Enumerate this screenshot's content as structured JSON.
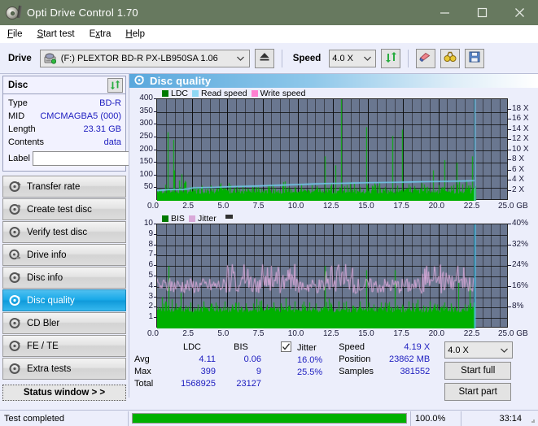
{
  "window": {
    "title": "Opti Drive Control 1.70",
    "icon": "disc-pen-icon",
    "minimize_label": "–",
    "maximize_label": "□",
    "close_label": "✕",
    "titlebar_color": "#67795f"
  },
  "menubar": {
    "items": [
      {
        "label": "File",
        "accel": "F"
      },
      {
        "label": "Start test",
        "accel": "S"
      },
      {
        "label": "Extra",
        "accel": "x"
      },
      {
        "label": "Help",
        "accel": "H"
      }
    ]
  },
  "toolbar": {
    "drive_label": "Drive",
    "drive_value": "(F:)  PLEXTOR BD-R  PX-LB950SA 1.06",
    "drive_icon": "drive-icon",
    "eject_icon": "eject-icon",
    "speed_label": "Speed",
    "speed_value": "4.0 X",
    "refresh_icon": "refresh-icon",
    "eraser_icon": "eraser-icon",
    "binoculars_icon": "binoculars-icon",
    "save_icon": "save-icon",
    "dropdown_icon": "chevron-down-icon"
  },
  "disc_panel": {
    "title": "Disc",
    "refresh_icon": "refresh-icon",
    "disc_icon": "disc-icon",
    "rows": [
      {
        "key": "Type",
        "value": "BD-R"
      },
      {
        "key": "MID",
        "value": "CMCMAGBA5 (000)"
      },
      {
        "key": "Length",
        "value": "23.31 GB"
      },
      {
        "key": "Contents",
        "value": "data"
      }
    ],
    "label_key": "Label",
    "label_value": ""
  },
  "sidebar": {
    "items": [
      {
        "label": "Transfer rate",
        "icon": "disc-test-icon",
        "active": false
      },
      {
        "label": "Create test disc",
        "icon": "disc-burn-icon",
        "active": false
      },
      {
        "label": "Verify test disc",
        "icon": "disc-verify-icon",
        "active": false
      },
      {
        "label": "Drive info",
        "icon": "disc-drive-icon",
        "active": false
      },
      {
        "label": "Disc info",
        "icon": "disc-info-icon",
        "active": false
      },
      {
        "label": "Disc quality",
        "icon": "disc-quality-icon",
        "active": true
      },
      {
        "label": "CD Bler",
        "icon": "disc-bler-icon",
        "active": false
      },
      {
        "label": "FE / TE",
        "icon": "disc-fete-icon",
        "active": false
      },
      {
        "label": "Extra tests",
        "icon": "disc-extra-icon",
        "active": false
      }
    ],
    "status_window_label": "Status window > >"
  },
  "panel": {
    "header_title": "Disc quality",
    "header_icon": "disc-quality-icon"
  },
  "stats": {
    "col_ldc": "LDC",
    "col_bis": "BIS",
    "rows": [
      {
        "key": "Avg",
        "ldc": "4.11",
        "bis": "0.06"
      },
      {
        "key": "Max",
        "ldc": "399",
        "bis": "9"
      },
      {
        "key": "Total",
        "ldc": "1568925",
        "bis": "23127"
      }
    ],
    "jitter_label": "Jitter",
    "jitter_checked": true,
    "jitter_avg": "16.0%",
    "jitter_max": "25.5%",
    "speed_key": "Speed",
    "speed_value": "4.19 X",
    "position_key": "Position",
    "position_value": "23862 MB",
    "samples_key": "Samples",
    "samples_value": "381552",
    "speed_select": "4.0 X",
    "start_full_label": "Start full",
    "start_part_label": "Start part"
  },
  "statusbar": {
    "text": "Test completed",
    "progress_percent": "100.0%",
    "progress_value": 100,
    "elapsed": "33:14"
  },
  "colors": {
    "ldc": "#00b000",
    "bis": "#00b000",
    "read_speed": "#74cdf0",
    "write_speed": "#ff66cc",
    "jitter": "#d9a9d9",
    "plot_bg": "#6a7790",
    "grid": "#141414",
    "accent": "#17a8e8"
  },
  "chart_data": [
    {
      "type": "line",
      "name": "top-chart",
      "title": "Disc quality",
      "xlabel": "GB",
      "ylabel": "LDC",
      "xlim": [
        0,
        25
      ],
      "ylim": [
        0,
        400
      ],
      "y2lim": [
        0,
        20
      ],
      "grid": true,
      "legend": [
        "LDC",
        "Read speed",
        "Write speed"
      ],
      "legend_position": "top-left",
      "xticks": [
        "0.0",
        "2.5",
        "5.0",
        "7.5",
        "10.0",
        "12.5",
        "15.0",
        "17.5",
        "20.0",
        "22.5",
        "25.0 GB"
      ],
      "yticks": [
        50,
        100,
        150,
        200,
        250,
        300,
        350,
        400
      ],
      "y2ticks": [
        "2 X",
        "4 X",
        "6 X",
        "8 X",
        "10 X",
        "12 X",
        "14 X",
        "16 X",
        "18 X"
      ],
      "series": [
        {
          "name": "LDC",
          "color": "#00b000",
          "type": "spikes",
          "baseline": 28,
          "noise": 22,
          "spikes": [
            [
              0.75,
              270
            ],
            [
              0.78,
              150
            ],
            [
              1.15,
              240
            ],
            [
              1.2,
              120
            ],
            [
              1.55,
              80
            ],
            [
              1.75,
              105
            ],
            [
              1.9,
              70
            ],
            [
              2.35,
              55
            ],
            [
              2.6,
              45
            ],
            [
              3.2,
              60
            ],
            [
              3.6,
              50
            ],
            [
              4.2,
              48
            ],
            [
              4.6,
              55
            ],
            [
              5.1,
              70
            ],
            [
              5.5,
              52
            ],
            [
              6.1,
              60
            ],
            [
              6.4,
              48
            ],
            [
              7.0,
              55
            ],
            [
              7.4,
              45
            ],
            [
              8.0,
              58
            ],
            [
              8.4,
              50
            ],
            [
              8.9,
              62
            ],
            [
              9.3,
              52
            ],
            [
              9.8,
              55
            ],
            [
              10.4,
              48
            ],
            [
              11.0,
              62
            ],
            [
              11.4,
              50
            ],
            [
              11.9,
              175
            ],
            [
              12.3,
              58
            ],
            [
              12.7,
              140
            ],
            [
              13.1,
              400
            ],
            [
              13.5,
              62
            ],
            [
              14.0,
              68
            ],
            [
              14.4,
              55
            ],
            [
              14.9,
              290
            ],
            [
              15.3,
              60
            ],
            [
              15.8,
              72
            ],
            [
              16.2,
              55
            ],
            [
              16.7,
              255
            ],
            [
              17.1,
              60
            ],
            [
              17.4,
              280
            ],
            [
              17.9,
              65
            ],
            [
              18.3,
              58
            ],
            [
              18.8,
              70
            ],
            [
              19.2,
              55
            ],
            [
              19.6,
              120
            ],
            [
              20.0,
              62
            ],
            [
              20.4,
              160
            ],
            [
              20.9,
              58
            ],
            [
              21.3,
              150
            ],
            [
              21.7,
              65
            ],
            [
              22.1,
              60
            ],
            [
              22.4,
              175
            ],
            [
              22.6,
              58
            ]
          ]
        },
        {
          "name": "Read speed",
          "color": "#74cdf0",
          "type": "step",
          "points": [
            [
              0.0,
              2.0
            ],
            [
              0.4,
              2.1
            ],
            [
              0.8,
              2.2
            ],
            [
              1.4,
              2.25
            ],
            [
              2.0,
              2.3
            ],
            [
              2.6,
              2.55
            ],
            [
              3.2,
              2.6
            ],
            [
              4.0,
              2.65
            ],
            [
              5.0,
              2.75
            ],
            [
              6.0,
              2.85
            ],
            [
              7.0,
              2.9
            ],
            [
              8.0,
              3.0
            ],
            [
              9.0,
              3.1
            ],
            [
              10.0,
              3.2
            ],
            [
              11.0,
              3.3
            ],
            [
              12.0,
              3.4
            ],
            [
              13.0,
              3.45
            ],
            [
              14.0,
              3.5
            ],
            [
              15.0,
              3.55
            ],
            [
              16.0,
              3.6
            ],
            [
              17.0,
              3.65
            ],
            [
              18.0,
              3.7
            ],
            [
              19.0,
              3.75
            ],
            [
              20.0,
              3.8
            ],
            [
              21.0,
              3.85
            ],
            [
              22.0,
              3.9
            ],
            [
              22.55,
              3.95
            ]
          ],
          "end_marker_x": 22.55
        },
        {
          "name": "Write speed",
          "color": "#ff66cc",
          "type": "none",
          "points": []
        }
      ]
    },
    {
      "type": "line",
      "name": "bottom-chart",
      "xlabel": "GB",
      "ylabel": "BIS",
      "xlim": [
        0,
        25
      ],
      "ylim": [
        0,
        10
      ],
      "y2lim": [
        0,
        50
      ],
      "grid": true,
      "legend": [
        "BIS",
        "Jitter"
      ],
      "legend_position": "top-left",
      "xticks": [
        "0.0",
        "2.5",
        "5.0",
        "7.5",
        "10.0",
        "12.5",
        "15.0",
        "17.5",
        "20.0",
        "22.5",
        "25.0 GB"
      ],
      "yticks": [
        1,
        2,
        3,
        4,
        5,
        6,
        7,
        8,
        9,
        10
      ],
      "y2ticks": [
        "8%",
        "16%",
        "24%",
        "32%",
        "40%"
      ],
      "series": [
        {
          "name": "BIS",
          "color": "#00b000",
          "type": "spikes",
          "baseline": 1.55,
          "noise": 0.55,
          "spikes": [
            [
              0.35,
              3.0
            ],
            [
              0.55,
              2.6
            ],
            [
              0.8,
              6.0
            ],
            [
              1.05,
              2.8
            ],
            [
              1.35,
              2.4
            ],
            [
              1.7,
              3.4
            ],
            [
              2.0,
              2.2
            ],
            [
              2.4,
              2.5
            ],
            [
              2.9,
              2.3
            ],
            [
              3.3,
              2.6
            ],
            [
              3.8,
              2.4
            ],
            [
              4.3,
              2.2
            ],
            [
              4.8,
              2.6
            ],
            [
              5.3,
              2.3
            ],
            [
              5.8,
              2.5
            ],
            [
              6.3,
              2.2
            ],
            [
              6.8,
              2.4
            ],
            [
              7.3,
              2.6
            ],
            [
              7.8,
              2.3
            ],
            [
              8.3,
              2.5
            ],
            [
              8.8,
              2.4
            ],
            [
              9.3,
              2.2
            ],
            [
              9.8,
              2.6
            ],
            [
              10.3,
              2.3
            ],
            [
              10.8,
              2.5
            ],
            [
              11.3,
              2.4
            ],
            [
              11.9,
              6.0
            ],
            [
              12.4,
              2.3
            ],
            [
              12.9,
              2.6
            ],
            [
              13.4,
              2.4
            ],
            [
              13.9,
              2.2
            ],
            [
              14.4,
              2.6
            ],
            [
              14.9,
              5.6
            ],
            [
              15.4,
              2.3
            ],
            [
              15.9,
              2.5
            ],
            [
              16.4,
              2.4
            ],
            [
              16.9,
              5.6
            ],
            [
              17.4,
              2.3
            ],
            [
              17.9,
              2.6
            ],
            [
              18.4,
              2.4
            ],
            [
              18.9,
              2.2
            ],
            [
              19.4,
              2.6
            ],
            [
              19.9,
              2.3
            ],
            [
              20.4,
              2.5
            ],
            [
              20.9,
              2.4
            ],
            [
              21.4,
              4.6
            ],
            [
              21.9,
              2.3
            ],
            [
              22.2,
              4.4
            ],
            [
              22.5,
              2.5
            ]
          ]
        },
        {
          "name": "Jitter",
          "color": "#d9a9d9",
          "type": "noisy-line",
          "baseline": 4.1,
          "amplitude": 0.75,
          "bursts": [
            [
              5.0,
              7.5,
              6.2
            ],
            [
              7.4,
              9.9,
              6.2
            ],
            [
              12.0,
              14.0,
              6.2
            ],
            [
              18.5,
              22.3,
              6.2
            ]
          ],
          "end_marker_x": 22.55
        }
      ]
    }
  ]
}
